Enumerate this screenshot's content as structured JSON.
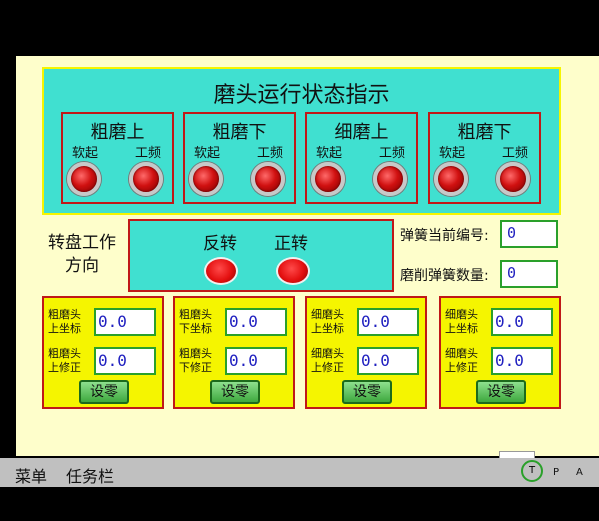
{
  "status_panel": {
    "title": "磨头运行状态指示",
    "sub_labels": {
      "soft_start": "软起",
      "power_freq": "工频"
    },
    "motors": [
      {
        "name": "粗磨上"
      },
      {
        "name": "粗磨下"
      },
      {
        "name": "细磨上"
      },
      {
        "name": "粗磨下"
      }
    ]
  },
  "turntable": {
    "label_line1": "转盘工作",
    "label_line2": "方向",
    "reverse": "反转",
    "forward": "正转"
  },
  "info": {
    "spring_no_label": "弹簧当前编号:",
    "spring_no_value": "0",
    "spring_count_label": "磨削弹簧数量:",
    "spring_count_value": "0"
  },
  "coord_panels": [
    {
      "lbl1a": "粗磨头",
      "lbl1b": "上坐标",
      "val1": "0.0",
      "lbl2a": "粗磨头",
      "lbl2b": "上修正",
      "val2": "0.0",
      "button": "设零"
    },
    {
      "lbl1a": "粗磨头",
      "lbl1b": "下坐标",
      "val1": "0.0",
      "lbl2a": "粗磨头",
      "lbl2b": "下修正",
      "val2": "0.0",
      "button": "设零"
    },
    {
      "lbl1a": "细磨头",
      "lbl1b": "上坐标",
      "val1": "0.0",
      "lbl2a": "细磨头",
      "lbl2b": "上修正",
      "val2": "0.0",
      "button": "设零"
    },
    {
      "lbl1a": "细磨头",
      "lbl1b": "上坐标",
      "val1": "0.0",
      "lbl2a": "细磨头",
      "lbl2b": "上修正",
      "val2": "0.0",
      "button": "设零"
    }
  ],
  "taskbar": {
    "menu": "菜单",
    "tasks": "任务栏",
    "t": "T",
    "p": "P",
    "a": "A"
  },
  "colors": {
    "screen_bg": "#fefecb",
    "panel_cyan": "#40e0d0",
    "panel_yellow": "#f5f500",
    "border_red": "#c01818",
    "field_border": "#2aa02a",
    "value_blue": "#2020c0",
    "lamp_red": "#e41010"
  }
}
